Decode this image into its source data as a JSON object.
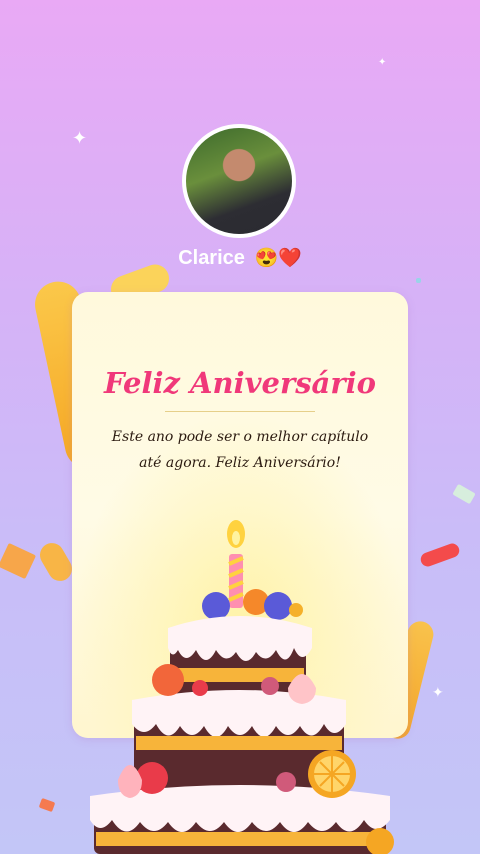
{
  "profile": {
    "name": "Clarice",
    "emojis": "😍❤️"
  },
  "card": {
    "title": "Feliz Aniversário",
    "message": "Este ano pode ser o melhor capítulo até agora. Feliz Aniversário!"
  },
  "colors": {
    "title": "#f0387a",
    "background_top": "#e9a9f5",
    "background_bottom": "#c3c6f7",
    "card": "#fffbe6"
  },
  "icons": [
    "sparkle-icon",
    "birthday-cake-icon",
    "candle-icon"
  ]
}
